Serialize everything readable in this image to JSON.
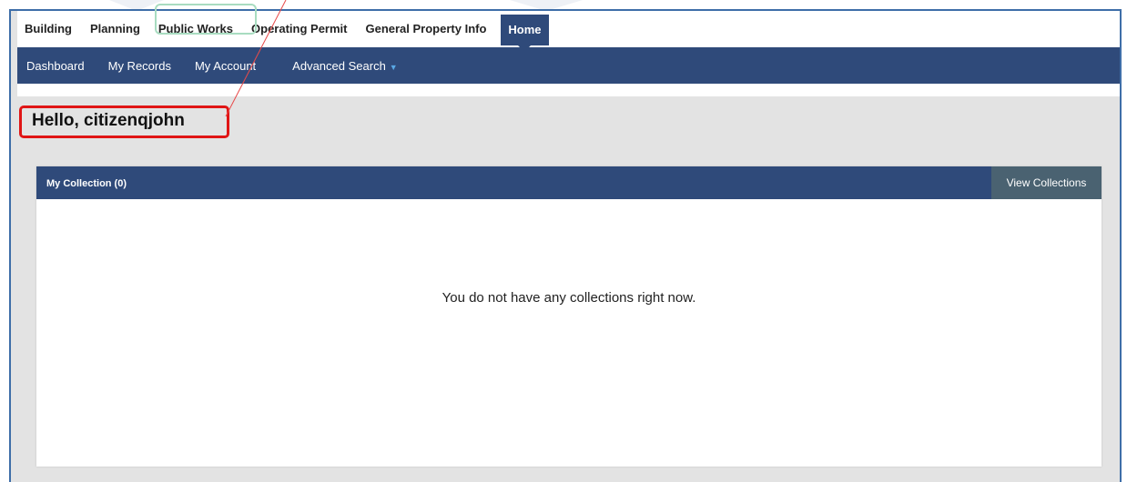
{
  "top_nav": {
    "tabs": [
      "Building",
      "Planning",
      "Public Works",
      "Operating Permit",
      "General Property Info"
    ],
    "active_tab": "Home"
  },
  "sub_nav": {
    "items": [
      "Dashboard",
      "My Records",
      "My Account"
    ],
    "advanced_search": "Advanced Search"
  },
  "greeting": "Hello, citizenqjohn",
  "collection_panel": {
    "title": "My Collection (0)",
    "view_button": "View Collections",
    "empty_message": "You do not have any collections right now."
  },
  "annotation_colors": {
    "greeting_box": "#e01515",
    "tab_box": "#a8dcc0",
    "connector_line": "#e84a4a"
  },
  "theme": {
    "nav_bg": "#2f4a7a",
    "button_bg": "#4a6271",
    "page_bg": "#e3e3e3"
  }
}
